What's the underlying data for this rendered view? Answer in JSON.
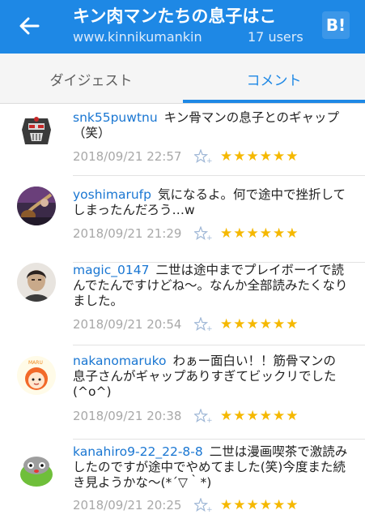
{
  "appbar": {
    "title": "キン肉マンたちの息子はこ",
    "domain": "www.kinnikumankin",
    "users": "17 users",
    "bookmark_button": "B!",
    "colors": {
      "bar": "#1e88e5",
      "text": "#ffffff"
    }
  },
  "tabs": [
    {
      "label": "ダイジェスト",
      "selected": false
    },
    {
      "label": "コメント",
      "selected": true
    }
  ],
  "comments": [
    {
      "username": "snk55puwtnu",
      "text": "キン骨マンの息子とのギャップ（笑）",
      "time": "2018/09/21 22:57",
      "stars": "★★★★★★",
      "avatar": "robot-mask-avatar"
    },
    {
      "username": "yoshimarufp",
      "text": "気になるよ。何で途中で挫折してしまったんだろう…w",
      "time": "2018/09/21 21:29",
      "stars": "★★★★★★",
      "avatar": "guitar-photo-avatar"
    },
    {
      "username": "magic_0147",
      "text": "二世は途中までプレイボーイで読んでたんですけどね〜。なんか全部読みたくなりました。",
      "time": "2018/09/21 20:54",
      "stars": "★★★★★★",
      "avatar": "man-photo-avatar"
    },
    {
      "username": "nakanomaruko",
      "text": "わぁー面白い！！筋骨マンの息子さんがギャップありすぎてビックリでした(^o^)",
      "time": "2018/09/21 20:38",
      "stars": "★★★★★★",
      "avatar": "cartoon-girl-avatar"
    },
    {
      "username": "kanahiro9-22_22-8-8",
      "text": "二世は漫画喫茶で激読みしたのですが途中でやめてました(笑)今度また続き見ようかな〜(*´▽｀*)",
      "time": "2018/09/21 20:25",
      "stars": "★★★★★★",
      "avatar": "green-blob-avatar"
    }
  ]
}
